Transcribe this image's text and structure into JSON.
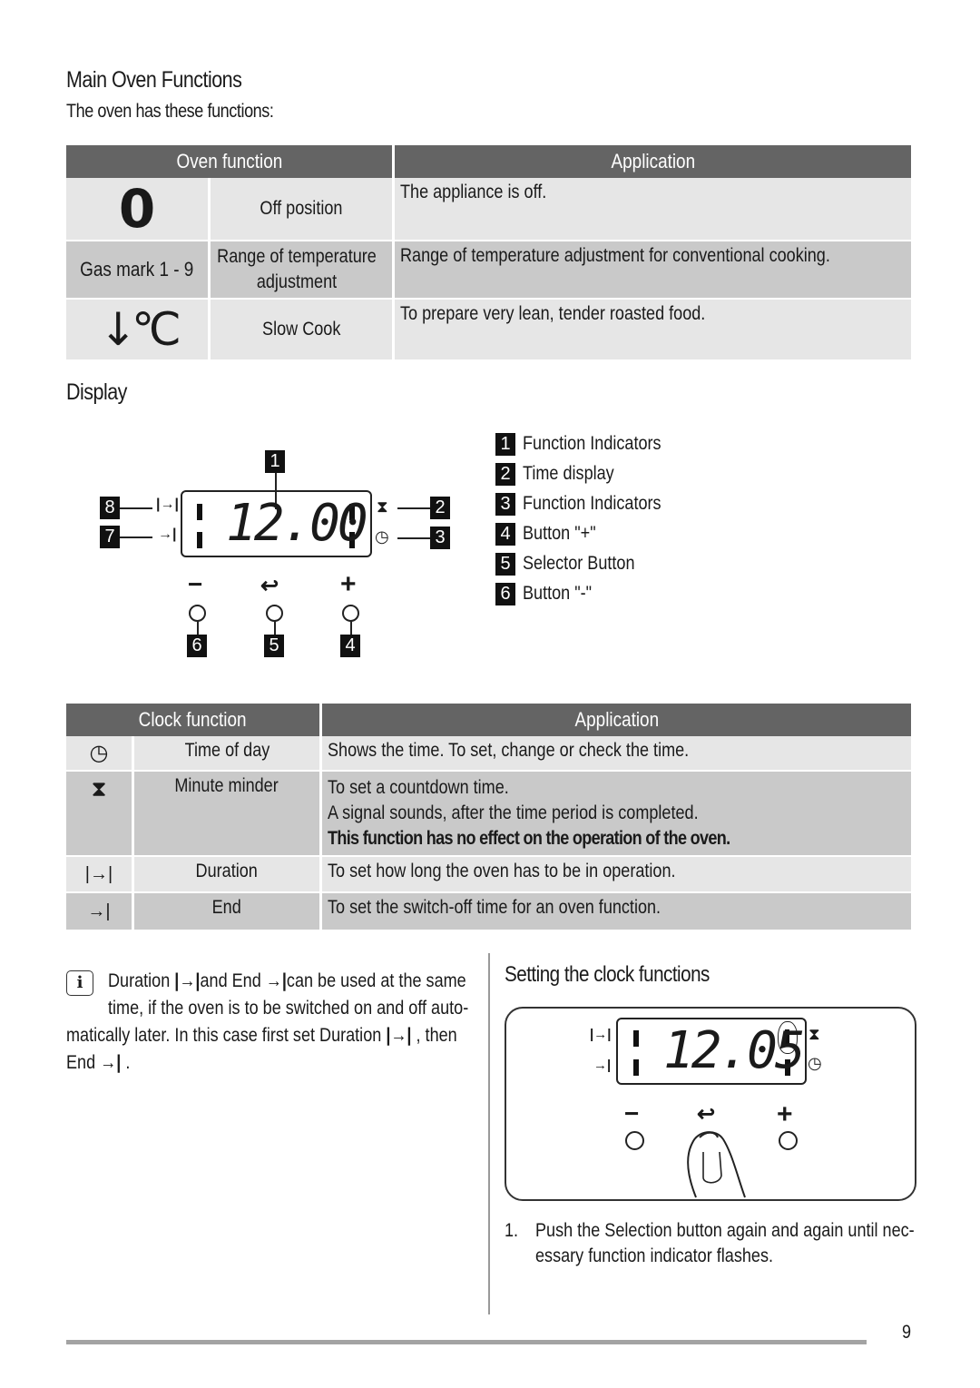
{
  "main_oven": {
    "title": "Main Oven Functions",
    "intro": "The oven has these functions:",
    "headers": {
      "function": "Oven function",
      "application": "Application"
    },
    "rows": [
      {
        "symbol": "0",
        "symbol_type": "off-symbol",
        "name": "Off position",
        "application": "The appliance is off."
      },
      {
        "symbol": "Gas mark 1 - 9",
        "symbol_type": "text",
        "name": "Range of temperature adjustment",
        "application": "Range of temperature adjustment for conventional cooking."
      },
      {
        "symbol": "↓°C",
        "symbol_type": "slow-cook-icon",
        "name": "Slow Cook",
        "application": "To prepare very lean, tender roasted food."
      }
    ]
  },
  "display": {
    "title": "Display",
    "time": "12.00",
    "callouts": [
      "1",
      "2",
      "3",
      "4",
      "5",
      "6",
      "7",
      "8"
    ],
    "legend": [
      {
        "num": "1",
        "label": "Function Indicators"
      },
      {
        "num": "2",
        "label": "Time display"
      },
      {
        "num": "3",
        "label": "Function Indicators"
      },
      {
        "num": "4",
        "label": "Button \"+\""
      },
      {
        "num": "5",
        "label": "Selector Button"
      },
      {
        "num": "6",
        "label": "Button \"-\""
      }
    ],
    "buttons": {
      "minus": "−",
      "select": "↩",
      "plus": "+"
    }
  },
  "clock_table": {
    "headers": {
      "function": "Clock function",
      "application": "Application"
    },
    "rows": [
      {
        "icon": "clock-icon",
        "name": "Time of day",
        "application": [
          "Shows the time. To set, change or check the time."
        ],
        "bold": ""
      },
      {
        "icon": "hourglass-icon",
        "name": "Minute minder",
        "application": [
          "To set a countdown time.",
          "A signal sounds, after the time period is completed."
        ],
        "bold": "This function has no effect on the operation of the oven."
      },
      {
        "icon": "duration-icon",
        "name": "Duration",
        "application": [
          "To set how long the oven has to be in operation."
        ],
        "bold": ""
      },
      {
        "icon": "end-icon",
        "name": "End",
        "application": [
          "To set the switch-off time for an oven function."
        ],
        "bold": ""
      }
    ]
  },
  "note": {
    "icon": "info-icon",
    "part1": "Duration",
    "part2": "and End",
    "part3": "can be used at the same",
    "line2": "time, if the oven is to be switched on and off auto-",
    "line3a": "matically later. In this case first set Duration",
    "line3b": ", then",
    "line4a": "End",
    "line4b": "."
  },
  "setting": {
    "title": "Setting the clock functions",
    "time": "12.05",
    "steps": [
      {
        "num": "1.",
        "text1": "Push the Selection button again and again until nec-",
        "text2": "essary function indicator flashes."
      }
    ]
  },
  "footer": {
    "page_number": "9"
  }
}
